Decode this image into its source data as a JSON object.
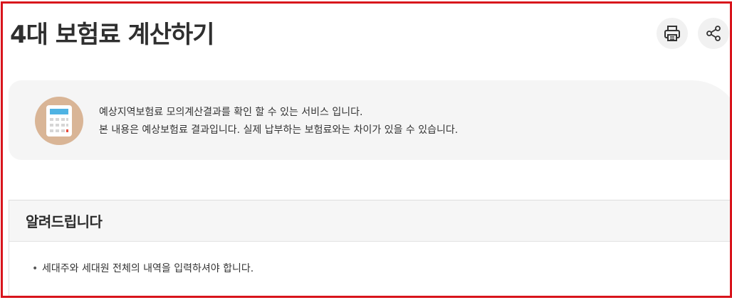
{
  "page": {
    "title": "4대 보험료 계산하기"
  },
  "toolbar": {
    "print_icon": "printer-icon",
    "share_icon": "share-icon"
  },
  "info": {
    "icon": "calculator-icon",
    "line1": "예상지역보험료 모의계산결과를 확인 할 수 있는 서비스 입니다.",
    "line2": "본 내용은 예상보험료 결과입니다. 실제 납부하는 보험료와는 차이가 있을 수 있습니다."
  },
  "notice": {
    "title": "알려드립니다",
    "items": [
      "세대주와 세대원 전체의 내역을 입력하셔야 합니다."
    ]
  },
  "colors": {
    "frame": "#d8141c",
    "icon_bg": "#d9b596",
    "calc_screen": "#4fb3e3",
    "calc_key_red": "#e94b3c"
  }
}
